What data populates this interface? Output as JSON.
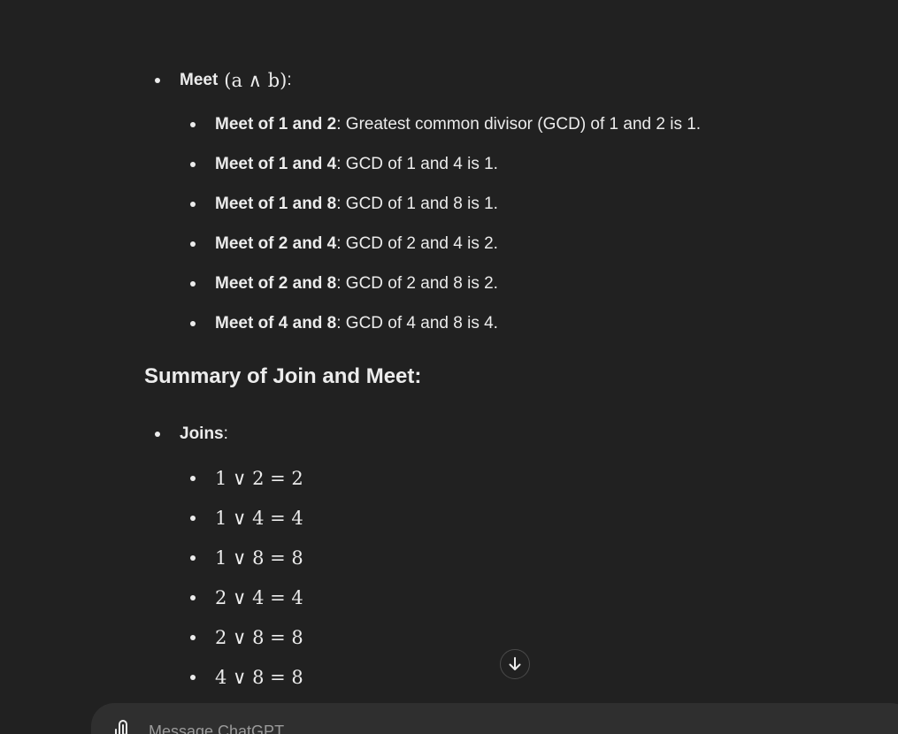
{
  "meet_section": {
    "label": "Meet",
    "math": "(a ∧ b)",
    "suffix": ":",
    "items": [
      {
        "bold": "Meet of 1 and 2",
        "text": ": Greatest common divisor (GCD) of 1 and 2 is 1."
      },
      {
        "bold": "Meet of 1 and 4",
        "text": ": GCD of 1 and 4 is 1."
      },
      {
        "bold": "Meet of 1 and 8",
        "text": ": GCD of 1 and 8 is 1."
      },
      {
        "bold": "Meet of 2 and 4",
        "text": ": GCD of 2 and 4 is 2."
      },
      {
        "bold": "Meet of 2 and 8",
        "text": ": GCD of 2 and 8 is 2."
      },
      {
        "bold": "Meet of 4 and 8",
        "text": ": GCD of 4 and 8 is 4."
      }
    ]
  },
  "summary": {
    "heading": "Summary of Join and Meet:",
    "joins_label": "Joins",
    "joins_suffix": ":",
    "joins": [
      "1 ∨ 2 = 2",
      "1 ∨ 4 = 4",
      "1 ∨ 8 = 8",
      "2 ∨ 4 = 4",
      "2 ∨ 8 = 8",
      "4 ∨ 8 = 8"
    ]
  },
  "scroll_button": {
    "icon": "arrow-down-icon"
  },
  "composer": {
    "placeholder": "Message ChatGPT",
    "attach_icon": "paperclip-icon"
  },
  "colors": {
    "background": "#212121",
    "text": "#ececec",
    "composer_bg": "#2f2f2f",
    "placeholder": "#9b9b9b"
  }
}
